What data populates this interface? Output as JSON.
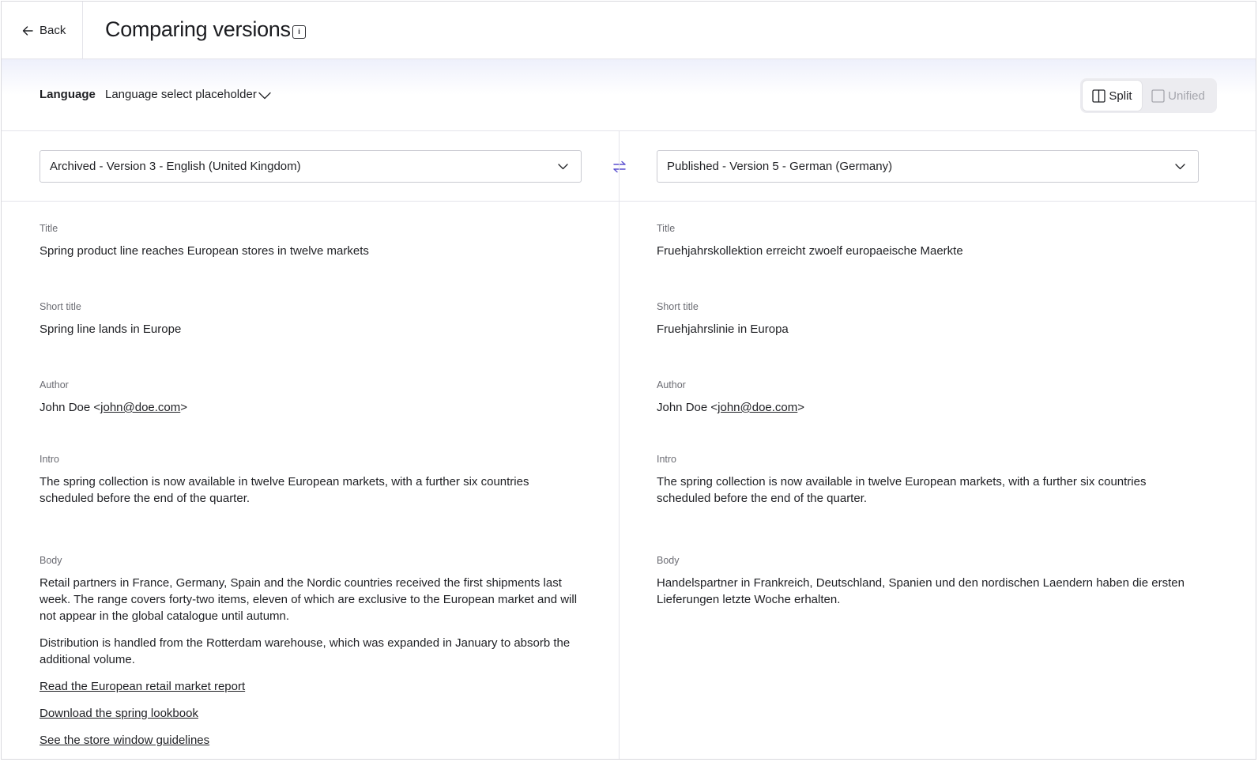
{
  "header": {
    "back_label": "Back",
    "title": "Comparing versions",
    "info_glyph": "i"
  },
  "language_bar": {
    "label": "Language",
    "select_value": "Language select placeholder",
    "view_modes": [
      "Split",
      "Unified"
    ],
    "active_view": "Split"
  },
  "versions": {
    "left": "Archived - Version 3 - English (United Kingdom)",
    "right": "Published - Version 5 - German (Germany)"
  },
  "left": {
    "title_label": "Title",
    "title": "Spring product line reaches European stores in twelve markets",
    "short_title_label": "Short title",
    "short_title": "Spring line lands in Europe",
    "author_label": "Author",
    "author_name": "John Doe <",
    "author_email": "john@doe.com",
    "author_close": ">",
    "intro_label": "Intro",
    "intro": "The spring collection is now available in twelve European markets, with a further six countries scheduled before the end of the quarter.",
    "body_label": "Body",
    "body_p1": "Retail partners in France, Germany, Spain and the Nordic countries received the first shipments last week. The range covers forty-two items, eleven of which are exclusive to the European market and will not appear in the global catalogue until autumn.",
    "body_p2": "Distribution is handled from the Rotterdam warehouse, which was expanded in January to absorb the additional volume.",
    "links": [
      "Read the European retail market report",
      "Download the spring lookbook",
      "See the store window guidelines"
    ]
  },
  "right": {
    "title_label": "Title",
    "title": "Fruehjahrskollektion erreicht zwoelf europaeische Maerkte",
    "short_title_label": "Short title",
    "short_title": "Fruehjahrslinie in Europa",
    "author_label": "Author",
    "author_name": "John Doe <",
    "author_email": "john@doe.com",
    "author_close": ">",
    "intro_label": "Intro",
    "intro": "The spring collection is now available in twelve European markets, with a further six countries scheduled before the end of the quarter.",
    "body_label": "Body",
    "body_p1": "Handelspartner in Frankreich, Deutschland, Spanien und den nordischen Laendern haben die ersten Lieferungen letzte Woche erhalten."
  },
  "colors": {
    "accent": "#5a4fcf",
    "border": "#e4e4ea",
    "muted_text": "#6b6c73"
  },
  "icons": {
    "back": "arrow-left-icon",
    "info": "info-icon",
    "chevron": "chevron-down-icon",
    "split": "split-view-icon",
    "unified": "unified-view-icon",
    "swap": "swap-icon"
  }
}
